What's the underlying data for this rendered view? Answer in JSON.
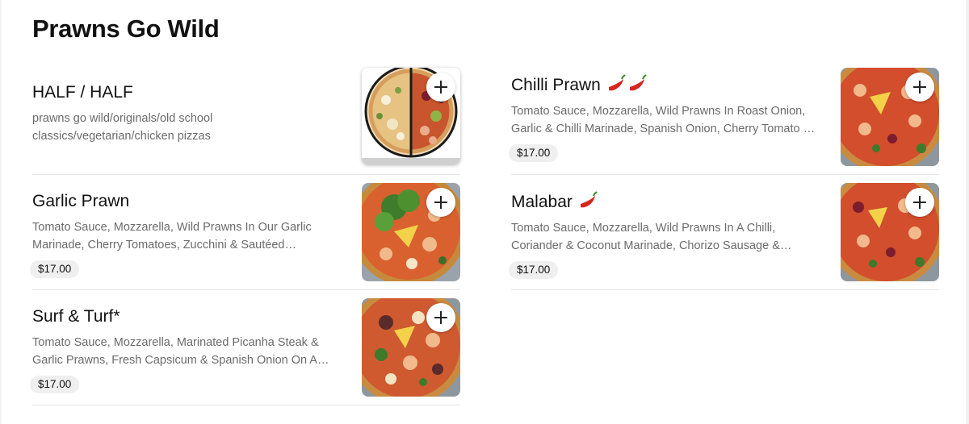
{
  "section": {
    "title": "Prawns Go Wild"
  },
  "left_items": [
    {
      "name": "HALF / HALF",
      "description": "prawns go wild/originals/old school classics/vegetarian/chicken pizzas",
      "price": "",
      "chillies": 0,
      "image": "half-half-pizza-image"
    },
    {
      "name": "Garlic Prawn",
      "description": "Tomato Sauce, Mozzarella, Wild Prawns In Our Garlic Marinade, Cherry Tomatoes, Zucchini & Sautéed…",
      "price": "$17.00",
      "chillies": 0,
      "image": "garlic-prawn-pizza-image"
    },
    {
      "name": "Surf & Turf*",
      "description": "Tomato Sauce, Mozzarella, Marinated Picanha Steak & Garlic Prawns, Fresh Capsicum & Spanish Onion On A…",
      "price": "$17.00",
      "chillies": 0,
      "image": "surf-and-turf-pizza-image"
    }
  ],
  "right_items": [
    {
      "name": "Chilli Prawn",
      "description": "Tomato Sauce, Mozzarella, Wild Prawns In Roast Onion, Garlic & Chilli Marinade, Spanish Onion, Cherry Tomato …",
      "price": "$17.00",
      "chillies": 2,
      "image": "chilli-prawn-pizza-image"
    },
    {
      "name": "Malabar",
      "description": "Tomato Sauce, Mozzarella, Wild Prawns In A Chilli, Coriander & Coconut Marinade, Chorizo Sausage &…",
      "price": "$17.00",
      "chillies": 1,
      "image": "malabar-pizza-image"
    }
  ],
  "colors": {
    "price_badge_bg": "#efefef",
    "divider": "#e6e6e6",
    "description_text": "#6b6b6b",
    "chilli": "#d7261e"
  },
  "icons": {
    "add": "plus-icon",
    "spicy": "chilli-pepper-icon"
  }
}
